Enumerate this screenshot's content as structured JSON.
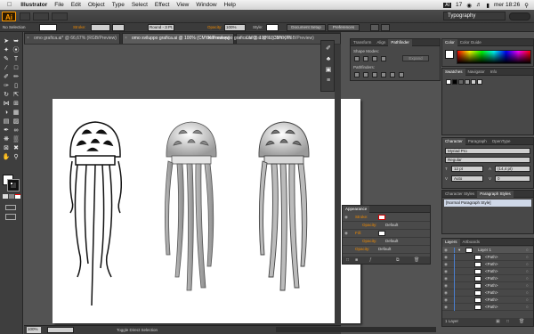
{
  "menubar": {
    "apple": "",
    "app_name": "Illustrator",
    "items": [
      "File",
      "Edit",
      "Object",
      "Type",
      "Select",
      "Effect",
      "View",
      "Window",
      "Help"
    ],
    "status": {
      "ai_badge": "AI",
      "badge_count": "17",
      "clock": "mer 18:26"
    }
  },
  "appbar": {
    "logo": "Ai",
    "workspace": "Typography"
  },
  "control": {
    "selection": "No Selection",
    "stroke_label": "Stroke:",
    "brush": "Round - 3 Pt.",
    "opacity_label": "Opacity:",
    "opacity_value": "100%",
    "style_label": "Style:",
    "document_setup": "Document Setup",
    "preferences": "Preferences"
  },
  "documents": [
    {
      "title": "omo grafica.ai* @ 66,67% (RGB/Preview)",
      "active": false
    },
    {
      "title": "omo sviluppo grafica.ai @ 100% (CMYK/Preview)",
      "active": true
    },
    {
      "title": "OMO.ai @ 33,33% (RGB/Preview)",
      "active": false
    }
  ],
  "window_title": "omo sviluppo grafica.ai @ 100% (CMYK/Pr",
  "status": {
    "zoom": "100%",
    "tool": "Toggle Direct Selection"
  },
  "panels": {
    "transform_group": {
      "tabs": [
        "Transform",
        "Align",
        "Pathfinder"
      ],
      "active_tab": "Pathfinder",
      "shape_modes": "Shape Modes:",
      "expand": "Expand",
      "pathfinders": "Pathfinders:"
    },
    "color_group": {
      "tabs": [
        "Color",
        "Color Guide"
      ]
    },
    "swatches_group": {
      "tabs": [
        "Swatches",
        "Navigator",
        "Info"
      ]
    },
    "character": {
      "tabs": [
        "Character",
        "Paragraph",
        "OpenType"
      ],
      "font": "Myriad Pro",
      "style": "Regular",
      "size": "12 pt",
      "leading": "(14,4 pt)",
      "tracking": "Auto",
      "kerning": "0"
    },
    "styles": {
      "tabs": [
        "Character Styles",
        "Paragraph Styles"
      ],
      "items": [
        "[Normal Paragraph Style]"
      ]
    },
    "appearance": {
      "title": "Appearance",
      "rows": [
        {
          "label": "Stroke:",
          "value": ""
        },
        {
          "label": "Opacity:",
          "value": "Default"
        },
        {
          "label": "Fill:",
          "value": ""
        },
        {
          "label": "Opacity:",
          "value": "Default"
        },
        {
          "label": "Opacity:",
          "value": "Default"
        }
      ],
      "footer": "Opacity: Default"
    },
    "layers": {
      "tabs": [
        "Layers",
        "Artboards"
      ],
      "layer_name": "Layer 1",
      "items": [
        "<Path>",
        "<Path>",
        "<Path>",
        "<Path>",
        "<Path>",
        "<Path>",
        "<Path>",
        "<Path>"
      ],
      "footer": "1 Layer"
    }
  },
  "colors": {
    "accent": "#f08a00",
    "selection_blue": "#4a7fd0"
  }
}
